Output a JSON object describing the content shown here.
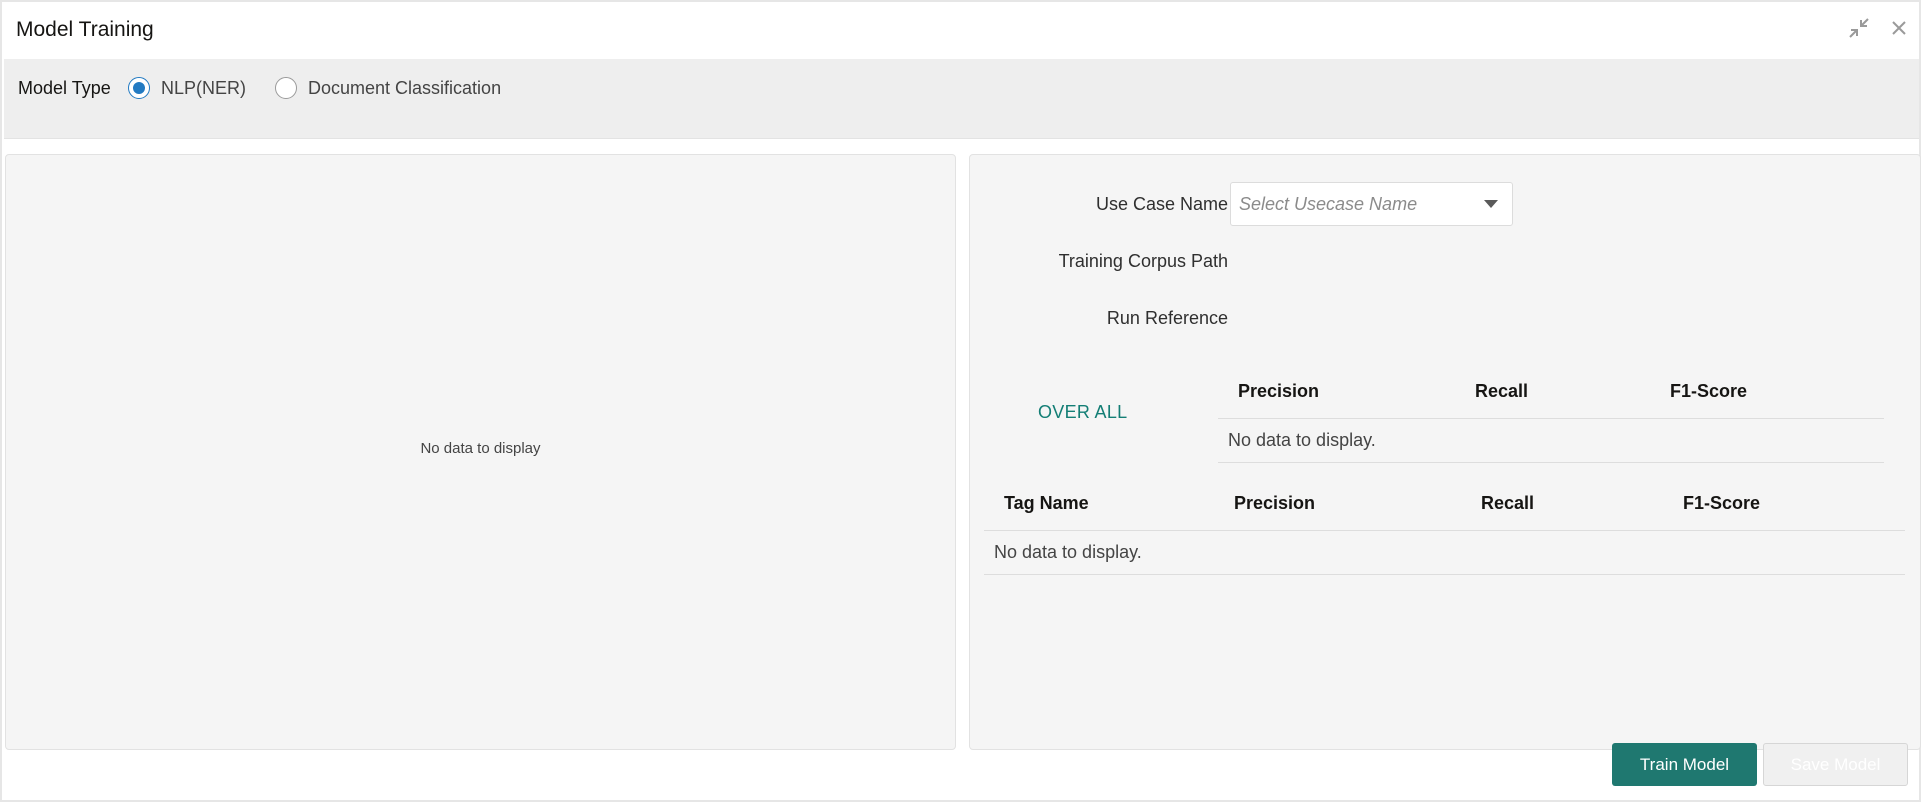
{
  "window": {
    "title": "Model Training",
    "minimize_icon": "minimize-icon",
    "close_icon": "close-icon"
  },
  "model_type": {
    "label": "Model Type",
    "options": [
      {
        "label": "NLP(NER)",
        "checked": true
      },
      {
        "label": "Document Classification",
        "checked": false
      }
    ]
  },
  "left_panel": {
    "empty_text": "No data to display"
  },
  "right_panel": {
    "use_case_label": "Use Case Name",
    "use_case_placeholder": "Select Usecase Name",
    "corpus_path_label": "Training Corpus Path",
    "run_reference_label": "Run Reference",
    "overall": {
      "link": "OVER ALL",
      "columns": [
        "Precision",
        "Recall",
        "F1-Score"
      ],
      "empty_text": "No data to display."
    },
    "tags": {
      "columns": [
        "Tag Name",
        "Precision",
        "Recall",
        "F1-Score"
      ],
      "empty_text": "No data to display."
    }
  },
  "actions": {
    "train_label": "Train Model",
    "save_label": "Save Model"
  },
  "colors": {
    "accent": "#1f7870",
    "radio_selected": "#227ac2",
    "link": "#137e75",
    "panel_bg": "#f5f5f5",
    "bar_bg": "#eeeeee"
  }
}
